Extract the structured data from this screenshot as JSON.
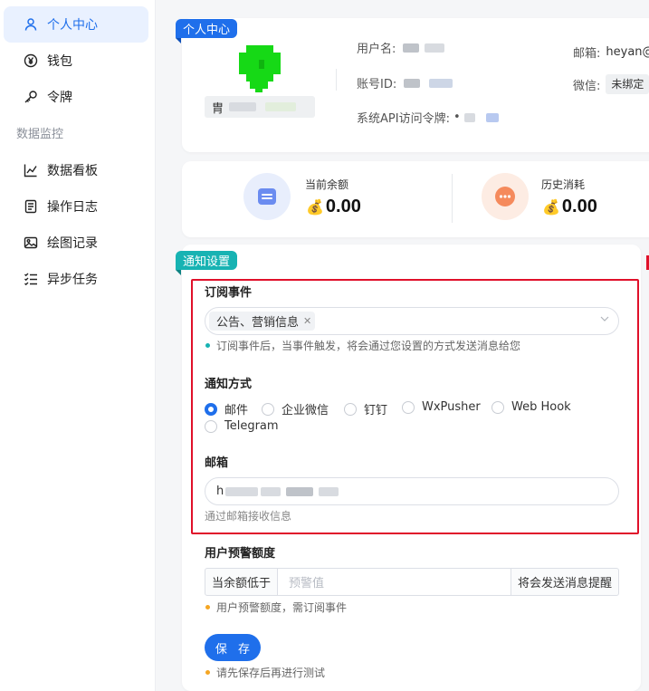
{
  "sidebar": {
    "items": [
      {
        "label": "个人中心",
        "icon": "user-icon",
        "active": true
      },
      {
        "label": "钱包",
        "icon": "yen-icon"
      },
      {
        "label": "令牌",
        "icon": "key-icon"
      }
    ],
    "section_label": "数据监控",
    "monitor_items": [
      {
        "label": "数据看板",
        "icon": "chart-line-icon"
      },
      {
        "label": "操作日志",
        "icon": "document-icon"
      },
      {
        "label": "绘图记录",
        "icon": "image-icon"
      },
      {
        "label": "异步任务",
        "icon": "task-list-icon"
      }
    ]
  },
  "profile": {
    "tag": "个人中心",
    "nickname_prefix": "胄",
    "username_label": "用户名:",
    "account_id_label": "账号ID:",
    "api_token_label": "系统API访问令牌:",
    "api_token_prefix": "•",
    "email_label": "邮箱:",
    "email_value": "heyan@",
    "wechat_label": "微信:",
    "wechat_value": "未绑定"
  },
  "stats": {
    "balance_label": "当前余额",
    "balance_value": "0.00",
    "consumed_label": "历史消耗",
    "consumed_value": "0.00",
    "money_icon": "money-bag-icon",
    "colors": {
      "balance_icon_bg": "#e8eefc",
      "balance_icon": "#6b8cf0",
      "consumed_icon_bg": "#fdece3",
      "consumed_icon": "#f58a5c"
    }
  },
  "notify": {
    "tag": "通知设置",
    "events_title": "订阅事件",
    "selected_event": "公告、营销信息",
    "events_hint": "订阅事件后，当事件触发，将会通过您设置的方式发送消息给您",
    "method_title": "通知方式",
    "methods": [
      "邮件",
      "企业微信",
      "钉钉",
      "WxPusher",
      "Web Hook",
      "Telegram"
    ],
    "selected_method": "邮件",
    "email_title": "邮箱",
    "email_value_prefix": "h",
    "email_hint": "通过邮箱接收信息",
    "warn_title": "用户预警额度",
    "warn_prefix": "当余额低于",
    "warn_placeholder": "预警值",
    "warn_suffix": "将会发送消息提醒",
    "warn_hint": "用户预警额度，需订阅事件",
    "save_label": "保 存",
    "save_hint": "请先保存后再进行测试"
  },
  "colors": {
    "primary": "#1f6feb",
    "teal_tag": "#17b3b3",
    "highlight_box": "#e0102a",
    "active_bg": "#e9f1ff"
  }
}
